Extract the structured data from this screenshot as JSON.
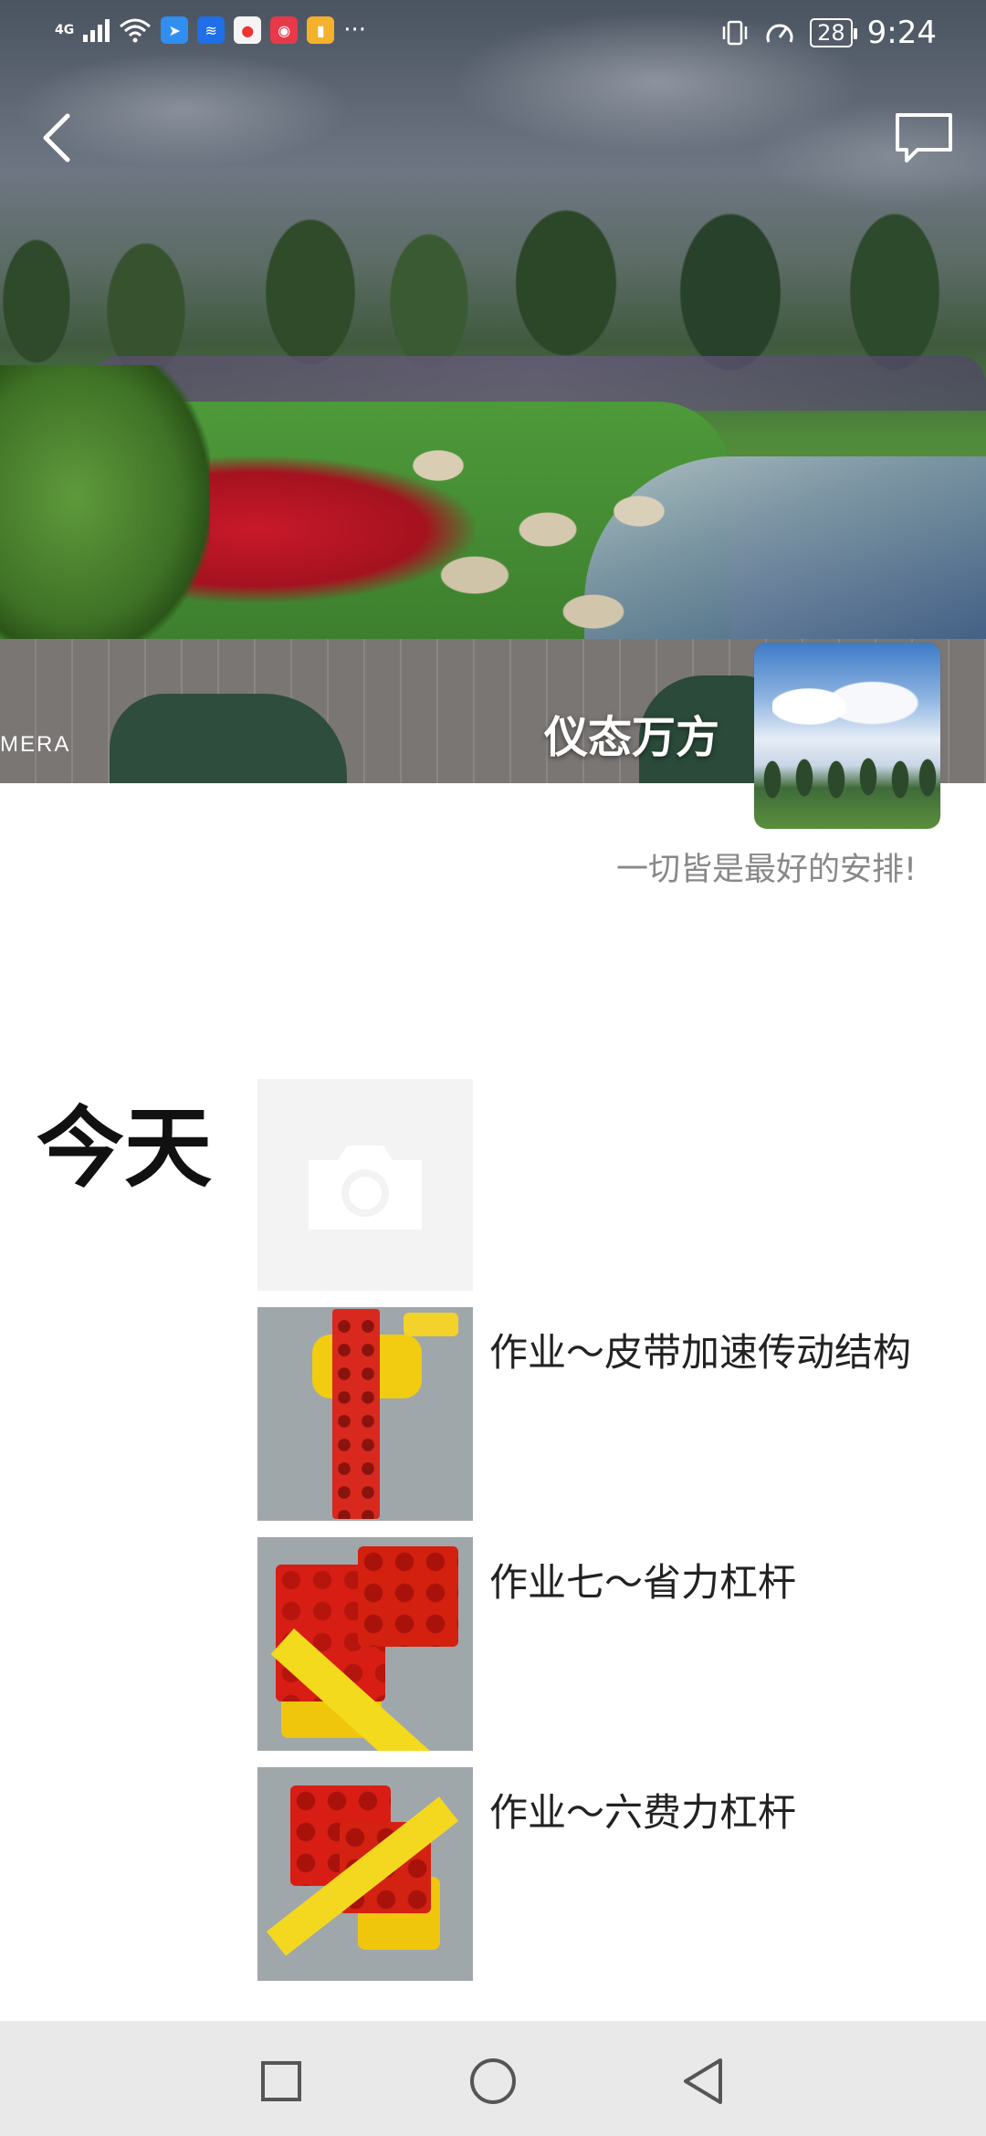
{
  "status_bar": {
    "network": "4G",
    "battery": "28",
    "time": "9:24",
    "more": "···",
    "icons": [
      "signal-icon",
      "wifi-icon",
      "app-icon-1",
      "app-icon-2",
      "app-icon-3",
      "app-icon-4",
      "app-icon-5",
      "vibrate-icon",
      "speed-icon",
      "battery-icon"
    ]
  },
  "header": {
    "back_icon": "chevron-left-icon",
    "message_icon": "comment-icon"
  },
  "profile": {
    "cover_watermark": "MERA",
    "nickname": "仪态万方",
    "signature": "一切皆是最好的安排!"
  },
  "feed": {
    "day_label": "今天",
    "placeholder_icon": "camera-icon",
    "posts": [
      {
        "caption": "作业～皮带加速传动结构"
      },
      {
        "caption": "作业七～省力杠杆"
      },
      {
        "caption": "作业～六费力杠杆"
      }
    ]
  },
  "nav_bar": {
    "items": [
      "recent-apps-icon",
      "home-icon",
      "back-icon"
    ]
  },
  "colors": {
    "nav_bg": "#e9e9e9",
    "signature_text": "#888888",
    "placeholder_bg": "#f3f3f3"
  }
}
